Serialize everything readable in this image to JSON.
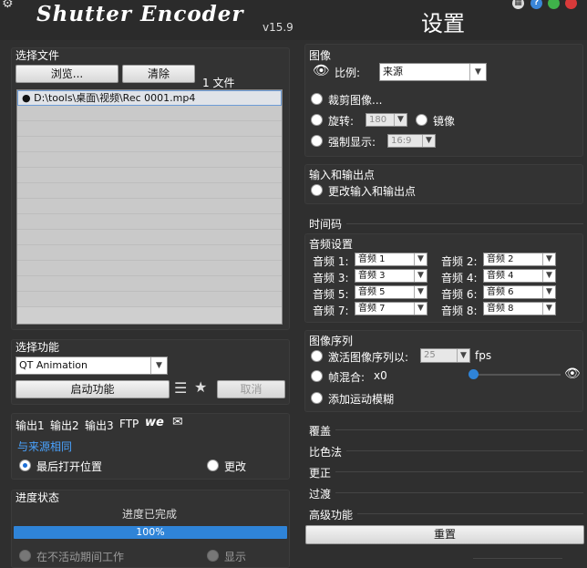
{
  "app": {
    "logo": "Shutter Encoder",
    "version": "v15.9",
    "settings_title": "设置"
  },
  "colors": {
    "background": "#2f2f2f",
    "accent": "#2f84d8",
    "link": "#4aa3ff"
  },
  "files": {
    "section_title": "选择文件",
    "browse_label": "浏览...",
    "clear_label": "清除",
    "count_label": "1 文件",
    "items": [
      "D:\\tools\\桌面\\视频\\Rec 0001.mp4"
    ]
  },
  "function": {
    "section_title": "选择功能",
    "selected": "QT Animation",
    "start_label": "启动功能",
    "cancel_label": "取消"
  },
  "output": {
    "tabs": [
      "输出1",
      "输出2",
      "输出3",
      "FTP"
    ],
    "same_as_source": "与来源相同",
    "last_open_location": "最后打开位置",
    "change_label": "更改"
  },
  "progress": {
    "section_title": "进度状态",
    "status": "进度已完成",
    "percent_text": "100%",
    "percent_value": 100,
    "work_when_inactive": "在不活动期间工作",
    "show_label": "显示"
  },
  "image": {
    "section_title": "图像",
    "ratio_label": "比例:",
    "ratio_value": "来源",
    "crop_label": "裁剪图像...",
    "rotate_label": "旋转:",
    "rotate_value": "180",
    "mirror_label": "镜像",
    "force_display_label": "强制显示:",
    "force_display_value": "16:9"
  },
  "inout": {
    "section_title": "输入和输出点",
    "change_label": "更改输入和输出点"
  },
  "timecode": {
    "section_title": "时间码"
  },
  "audio": {
    "section_title": "音频设置",
    "rows": [
      {
        "label": "音频 1:",
        "value": "音频 1"
      },
      {
        "label": "音频 2:",
        "value": "音频 2"
      },
      {
        "label": "音频 3:",
        "value": "音频 3"
      },
      {
        "label": "音频 4:",
        "value": "音频 4"
      },
      {
        "label": "音频 5:",
        "value": "音频 5"
      },
      {
        "label": "音频 6:",
        "value": "音频 6"
      },
      {
        "label": "音频 7:",
        "value": "音频 7"
      },
      {
        "label": "音频 8:",
        "value": "音频 8"
      }
    ]
  },
  "sequence": {
    "section_title": "图像序列",
    "activate_label": "激活图像序列以:",
    "fps_value": "25",
    "fps_unit": "fps",
    "blend_label": "帧混合:",
    "blend_value": "x0",
    "motion_blur_label": "添加运动模糊"
  },
  "collapsed_sections": [
    "覆盖",
    "比色法",
    "更正",
    "过渡",
    "高级功能"
  ],
  "reset_label": "重置"
}
